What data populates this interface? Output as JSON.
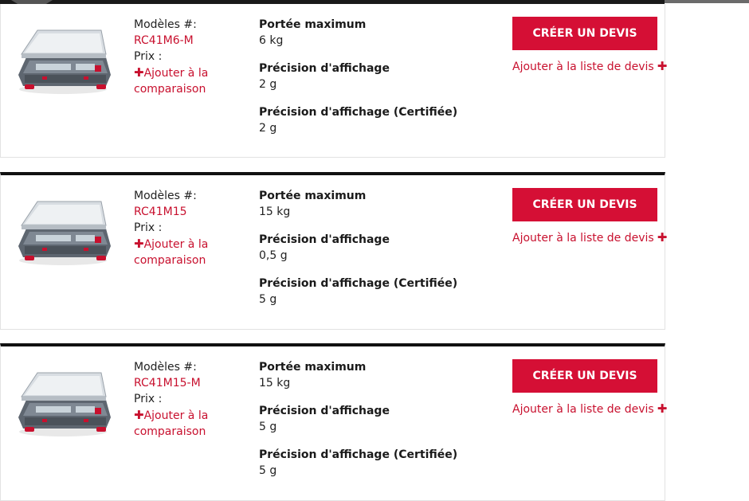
{
  "labels": {
    "model_prefix": "Modèles #:",
    "price_label": "Prix :",
    "compare_link": "Ajouter à la comparaison",
    "create_quote_button": "CRÉER UN DEVIS",
    "add_to_quote_link": "Ajouter à la liste de devis",
    "plus_symbol": "✚"
  },
  "products": [
    {
      "model": "RC41M6-M",
      "specs": [
        {
          "label": "Portée maximum",
          "value": "6 kg"
        },
        {
          "label": "Précision d'affichage",
          "value": "2 g"
        },
        {
          "label": "Précision d'affichage (Certifiée)",
          "value": "2 g"
        }
      ]
    },
    {
      "model": "RC41M15",
      "specs": [
        {
          "label": "Portée maximum",
          "value": "15 kg"
        },
        {
          "label": "Précision d'affichage",
          "value": "0,5 g"
        },
        {
          "label": "Précision d'affichage (Certifiée)",
          "value": "5 g"
        }
      ]
    },
    {
      "model": "RC41M15-M",
      "specs": [
        {
          "label": "Portée maximum",
          "value": "15 kg"
        },
        {
          "label": "Précision d'affichage",
          "value": "5 g"
        },
        {
          "label": "Précision d'affichage (Certifiée)",
          "value": "5 g"
        }
      ]
    }
  ],
  "colors": {
    "accent": "#d50f35",
    "link": "#c8102e",
    "card_border": "#e2e2e2",
    "card_top_border": "#111111"
  },
  "icons": {
    "product_image": "counting-scale-image",
    "plus": "plus-icon"
  }
}
